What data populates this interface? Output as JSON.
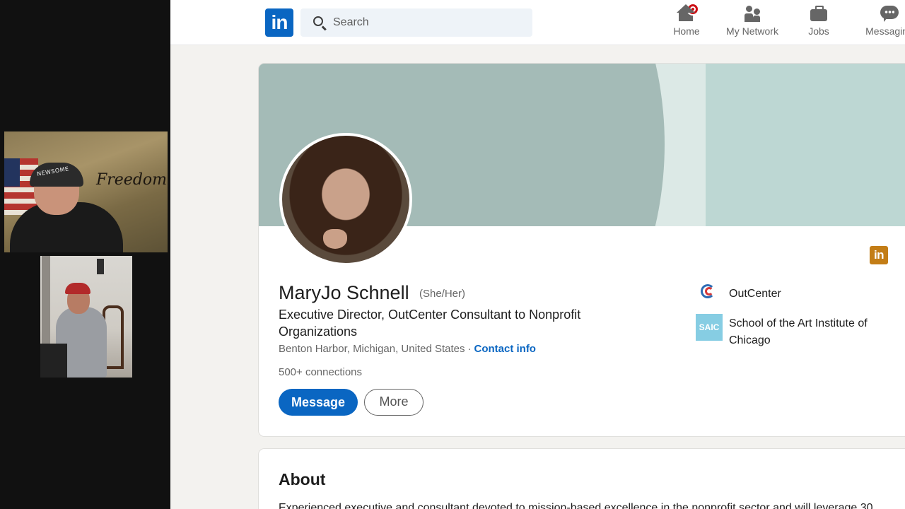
{
  "participants": {
    "cam1": {
      "overlay_text": "Freedom",
      "cap_text": "NEWSOME"
    }
  },
  "linkedin": {
    "logo": "in",
    "search": {
      "placeholder": "Search"
    },
    "nav": [
      {
        "label": "Home",
        "icon": "home-icon",
        "badge": true
      },
      {
        "label": "My Network",
        "icon": "network-icon"
      },
      {
        "label": "Jobs",
        "icon": "jobs-icon"
      },
      {
        "label": "Messaging",
        "icon": "messaging-icon"
      }
    ],
    "colors": {
      "brand": "#0a66c2",
      "badge": "#cc1016",
      "premium": "#c37d16"
    }
  },
  "profile": {
    "name": "MaryJo Schnell",
    "pronouns": "(She/Her)",
    "headline": "Executive Director, OutCenter Consultant to Nonprofit Organizations",
    "location": "Benton Harbor, Michigan, United States",
    "separator": "·",
    "contact_label": "Contact info",
    "connections": "500+ connections",
    "message_label": "Message",
    "more_label": "More",
    "corner_badge": "in",
    "orgs": [
      {
        "name": "OutCenter",
        "logo": "outcenter-logo"
      },
      {
        "name": "School of the Art Institute of Chicago",
        "logo": "saic-logo",
        "logo_text": "SAIC"
      }
    ]
  },
  "about": {
    "title": "About",
    "text": "Experienced executive and consultant devoted to mission-based excellence in the nonprofit sector and will leverage 30"
  }
}
